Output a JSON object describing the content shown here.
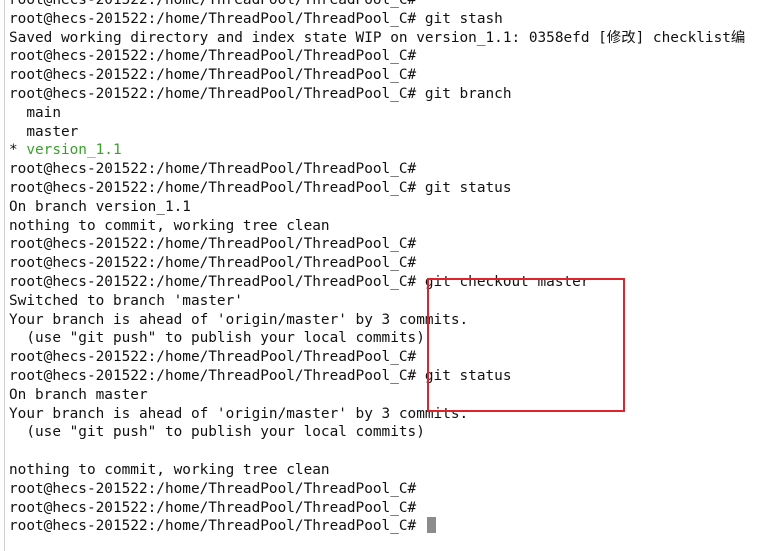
{
  "terminal": {
    "prompt": "root@hecs-201522:/home/ThreadPool/ThreadPool_C#",
    "highlight_color": "#e0222a",
    "current_branch_color": "#3aa12c",
    "lines": [
      {
        "type": "prompt",
        "command": ""
      },
      {
        "type": "prompt",
        "command": " git stash"
      },
      {
        "type": "output",
        "text": "Saved working directory and index state WIP on version_1.1: 0358efd [修改] checklist编"
      },
      {
        "type": "prompt",
        "command": ""
      },
      {
        "type": "prompt",
        "command": ""
      },
      {
        "type": "prompt",
        "command": " git branch"
      },
      {
        "type": "output",
        "text": "  main"
      },
      {
        "type": "output",
        "text": "  master"
      },
      {
        "type": "branch",
        "marker": "* ",
        "name": "version_1.1"
      },
      {
        "type": "prompt",
        "command": ""
      },
      {
        "type": "prompt",
        "command": " git status"
      },
      {
        "type": "output",
        "text": "On branch version_1.1"
      },
      {
        "type": "output",
        "text": "nothing to commit, working tree clean"
      },
      {
        "type": "prompt",
        "command": ""
      },
      {
        "type": "prompt",
        "command": ""
      },
      {
        "type": "prompt",
        "command": " git checkout master"
      },
      {
        "type": "output",
        "text": "Switched to branch 'master'"
      },
      {
        "type": "output",
        "text": "Your branch is ahead of 'origin/master' by 3 commits."
      },
      {
        "type": "output",
        "text": "  (use \"git push\" to publish your local commits)"
      },
      {
        "type": "prompt",
        "command": ""
      },
      {
        "type": "prompt",
        "command": " git status"
      },
      {
        "type": "output",
        "text": "On branch master"
      },
      {
        "type": "output",
        "text": "Your branch is ahead of 'origin/master' by 3 commits."
      },
      {
        "type": "output",
        "text": "  (use \"git push\" to publish your local commits)"
      },
      {
        "type": "output",
        "text": ""
      },
      {
        "type": "output",
        "text": "nothing to commit, working tree clean"
      },
      {
        "type": "prompt",
        "command": ""
      },
      {
        "type": "prompt",
        "command": ""
      },
      {
        "type": "prompt",
        "command": " ",
        "cursor": true
      }
    ]
  }
}
